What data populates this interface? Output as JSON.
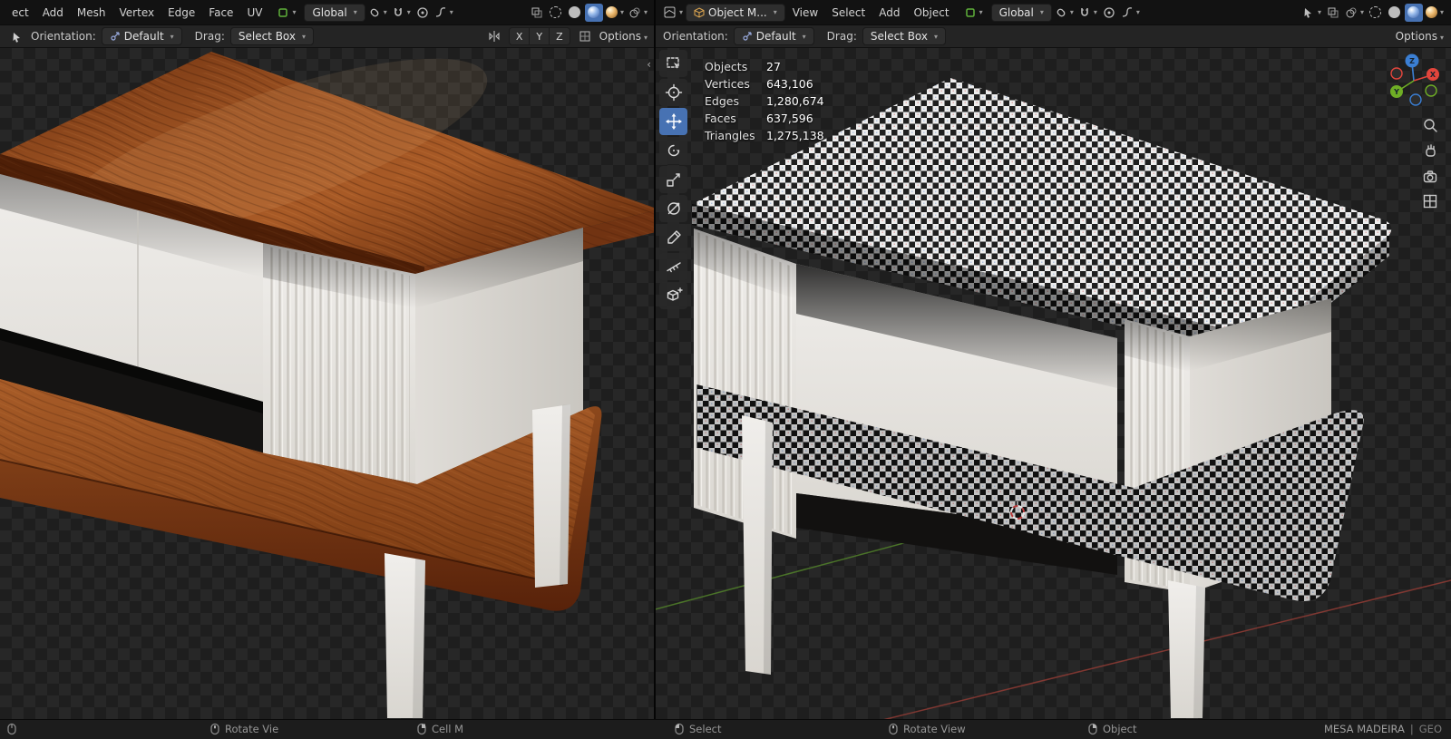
{
  "left_viewport": {
    "menubar": {
      "menus": [
        "ect",
        "Add",
        "Mesh",
        "Vertex",
        "Edge",
        "Face",
        "UV"
      ],
      "orientation": "Global"
    },
    "tool_row": {
      "orientation_label": "Orientation:",
      "orientation_value": "Default",
      "drag_label": "Drag:",
      "drag_value": "Select Box",
      "axes": [
        "X",
        "Y",
        "Z"
      ],
      "options_label": "Options"
    }
  },
  "right_viewport": {
    "menubar": {
      "mode": "Object M...",
      "menus": [
        "View",
        "Select",
        "Add",
        "Object"
      ],
      "orientation": "Global"
    },
    "tool_row": {
      "orientation_label": "Orientation:",
      "orientation_value": "Default",
      "drag_label": "Drag:",
      "drag_value": "Select Box",
      "options_label": "Options"
    },
    "stats": [
      {
        "label": "Objects",
        "value": "27"
      },
      {
        "label": "Vertices",
        "value": "643,106"
      },
      {
        "label": "Edges",
        "value": "1,280,674"
      },
      {
        "label": "Faces",
        "value": "637,596"
      },
      {
        "label": "Triangles",
        "value": "1,275,138"
      }
    ],
    "gizmo": {
      "x": "X",
      "y": "Y",
      "z": "Z"
    }
  },
  "status_bar": {
    "left_partial_1": "Rotate Vie",
    "left_partial_2": "Cell M",
    "select": "Select",
    "rotate_view": "Rotate View",
    "object": "Object",
    "scene": "MESA MADEIRA",
    "divider": "|",
    "collection": "GEO"
  },
  "colors": {
    "accent_blue": "#4772b3",
    "axis_x": "#e2453c",
    "axis_y": "#6fae25",
    "axis_z": "#3b7fd4",
    "wood": "#8a4a1d",
    "checker_light": "#ededed",
    "checker_dark": "#141414"
  }
}
